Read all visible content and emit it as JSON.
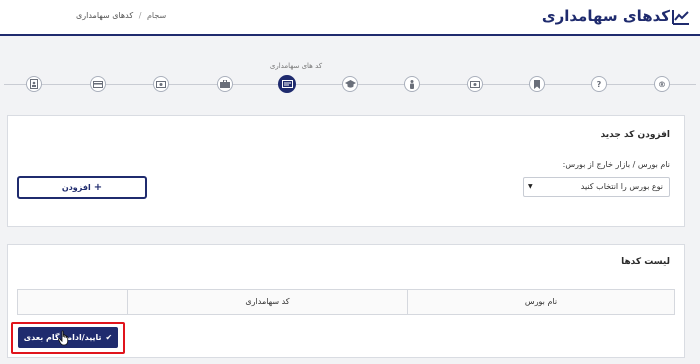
{
  "header": {
    "title": "کدهای سهامداری",
    "title_icon": "chart-line-icon",
    "breadcrumb": {
      "home": "سجام",
      "separator": "/",
      "current": "کدهای سهامداری"
    }
  },
  "steps": {
    "caption": "کد های سهامداری",
    "items": [
      {
        "icon": "registered-icon",
        "glyph": "®",
        "active": false
      },
      {
        "icon": "question-icon",
        "glyph": "?",
        "active": false
      },
      {
        "icon": "bookmark-icon",
        "glyph": "",
        "active": false
      },
      {
        "icon": "money-icon",
        "glyph": "",
        "active": false
      },
      {
        "icon": "person-icon",
        "glyph": "",
        "active": false
      },
      {
        "icon": "graduation-cap-icon",
        "glyph": "",
        "active": false
      },
      {
        "icon": "id-card-icon",
        "glyph": "",
        "active": true
      },
      {
        "icon": "briefcase-icon",
        "glyph": "",
        "active": false
      },
      {
        "icon": "money-icon",
        "glyph": "",
        "active": false
      },
      {
        "icon": "credit-card-icon",
        "glyph": "",
        "active": false
      },
      {
        "icon": "contact-card-icon",
        "glyph": "",
        "active": false
      }
    ]
  },
  "add_panel": {
    "heading": "افزودن کد جدید",
    "field_label": "نام بورس / بازار خارج از بورس:",
    "select_value": "نوع بورس را انتخاب کنید",
    "add_button": "افزودن"
  },
  "list_panel": {
    "heading": "لیست کدها",
    "columns": [
      "نام بورس",
      "کد سهامداری",
      ""
    ]
  },
  "footer": {
    "confirm_button": "تایید/ادامه گام بعدی"
  },
  "colors": {
    "primary": "#1f2b6e",
    "highlight": "#e0141c",
    "background": "#f2f3f5"
  }
}
